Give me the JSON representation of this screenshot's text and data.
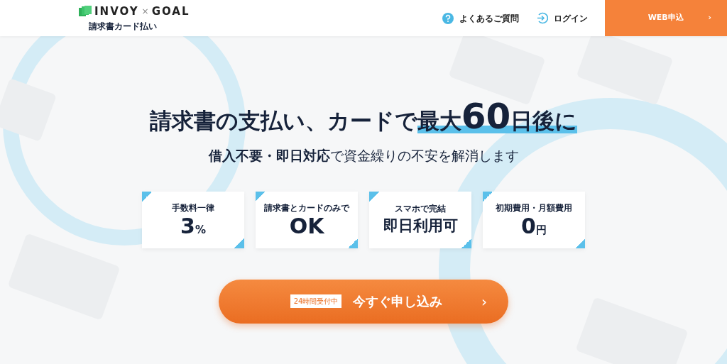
{
  "header": {
    "logo": {
      "brand_1": "INVOY",
      "separator": "×",
      "brand_2": "GOAL",
      "subtitle": "請求書カード払い"
    },
    "nav": [
      {
        "kind": "faq",
        "label": "よくあるご質問"
      },
      {
        "kind": "login",
        "label": "ログイン"
      }
    ],
    "cta": {
      "label": "WEB申込",
      "arrow": "›"
    }
  },
  "hero": {
    "headline": {
      "lead": "請求書の支払い、カードで",
      "highlight_start": "最大",
      "number": "60",
      "highlight_end": "日後に"
    },
    "subline": "**借入不要・即日対応**で資金繰りの不安を解消します",
    "features": [
      {
        "label": "手数料一律",
        "value": "3",
        "unit": "%"
      },
      {
        "label": "請求書とカードのみで",
        "value": "OK"
      },
      {
        "label": "スマホで完結",
        "value": "即日利用可"
      },
      {
        "label": "初期費用・月額費用",
        "value": "0",
        "unit": "円"
      }
    ],
    "apply_button": {
      "badge": "24時間受付中",
      "label": "今すぐ申し込み",
      "arrow": "›"
    }
  }
}
